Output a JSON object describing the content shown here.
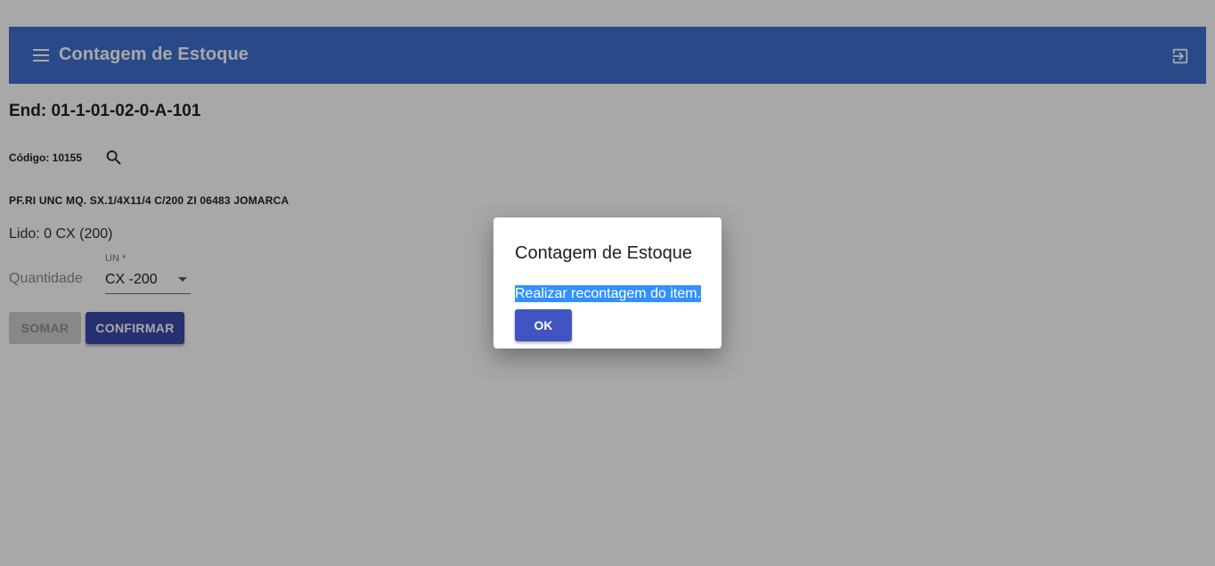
{
  "appbar": {
    "title": "Contagem de Estoque",
    "color": "#3f6fd1",
    "menu_icon": "hamburger-menu-icon",
    "exit_icon": "exit-to-app-icon"
  },
  "location": {
    "address": "End: 01-1-01-02-0-A-101",
    "code": "Código: 10155",
    "search_icon": "search-icon",
    "description": "PF.RI UNC MQ. SX.1/4X11/4 C/200 ZI 06483 JOMARCA",
    "read": "Lido: 0 CX (200)"
  },
  "form": {
    "quantity_placeholder": "Quantidade",
    "quantity_value": "",
    "unit_label": "UN *",
    "unit_value": "CX -200"
  },
  "buttons": {
    "sum_label": "SOMAR",
    "confirm_label": "CONFIRMAR"
  },
  "dialog": {
    "title": "Contagem de Estoque",
    "message": "Realizar recontagem do item.",
    "ok_label": "OK"
  }
}
